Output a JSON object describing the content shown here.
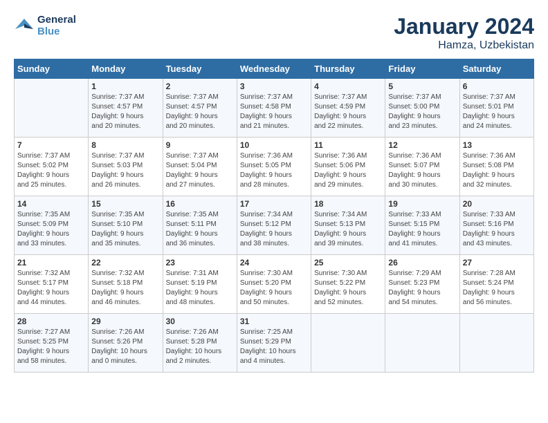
{
  "header": {
    "logo_line1": "General",
    "logo_line2": "Blue",
    "month_year": "January 2024",
    "location": "Hamza, Uzbekistan"
  },
  "days_of_week": [
    "Sunday",
    "Monday",
    "Tuesday",
    "Wednesday",
    "Thursday",
    "Friday",
    "Saturday"
  ],
  "weeks": [
    [
      {
        "day": "",
        "content": ""
      },
      {
        "day": "1",
        "content": "Sunrise: 7:37 AM\nSunset: 4:57 PM\nDaylight: 9 hours\nand 20 minutes."
      },
      {
        "day": "2",
        "content": "Sunrise: 7:37 AM\nSunset: 4:57 PM\nDaylight: 9 hours\nand 20 minutes."
      },
      {
        "day": "3",
        "content": "Sunrise: 7:37 AM\nSunset: 4:58 PM\nDaylight: 9 hours\nand 21 minutes."
      },
      {
        "day": "4",
        "content": "Sunrise: 7:37 AM\nSunset: 4:59 PM\nDaylight: 9 hours\nand 22 minutes."
      },
      {
        "day": "5",
        "content": "Sunrise: 7:37 AM\nSunset: 5:00 PM\nDaylight: 9 hours\nand 23 minutes."
      },
      {
        "day": "6",
        "content": "Sunrise: 7:37 AM\nSunset: 5:01 PM\nDaylight: 9 hours\nand 24 minutes."
      }
    ],
    [
      {
        "day": "7",
        "content": "Sunrise: 7:37 AM\nSunset: 5:02 PM\nDaylight: 9 hours\nand 25 minutes."
      },
      {
        "day": "8",
        "content": "Sunrise: 7:37 AM\nSunset: 5:03 PM\nDaylight: 9 hours\nand 26 minutes."
      },
      {
        "day": "9",
        "content": "Sunrise: 7:37 AM\nSunset: 5:04 PM\nDaylight: 9 hours\nand 27 minutes."
      },
      {
        "day": "10",
        "content": "Sunrise: 7:36 AM\nSunset: 5:05 PM\nDaylight: 9 hours\nand 28 minutes."
      },
      {
        "day": "11",
        "content": "Sunrise: 7:36 AM\nSunset: 5:06 PM\nDaylight: 9 hours\nand 29 minutes."
      },
      {
        "day": "12",
        "content": "Sunrise: 7:36 AM\nSunset: 5:07 PM\nDaylight: 9 hours\nand 30 minutes."
      },
      {
        "day": "13",
        "content": "Sunrise: 7:36 AM\nSunset: 5:08 PM\nDaylight: 9 hours\nand 32 minutes."
      }
    ],
    [
      {
        "day": "14",
        "content": "Sunrise: 7:35 AM\nSunset: 5:09 PM\nDaylight: 9 hours\nand 33 minutes."
      },
      {
        "day": "15",
        "content": "Sunrise: 7:35 AM\nSunset: 5:10 PM\nDaylight: 9 hours\nand 35 minutes."
      },
      {
        "day": "16",
        "content": "Sunrise: 7:35 AM\nSunset: 5:11 PM\nDaylight: 9 hours\nand 36 minutes."
      },
      {
        "day": "17",
        "content": "Sunrise: 7:34 AM\nSunset: 5:12 PM\nDaylight: 9 hours\nand 38 minutes."
      },
      {
        "day": "18",
        "content": "Sunrise: 7:34 AM\nSunset: 5:13 PM\nDaylight: 9 hours\nand 39 minutes."
      },
      {
        "day": "19",
        "content": "Sunrise: 7:33 AM\nSunset: 5:15 PM\nDaylight: 9 hours\nand 41 minutes."
      },
      {
        "day": "20",
        "content": "Sunrise: 7:33 AM\nSunset: 5:16 PM\nDaylight: 9 hours\nand 43 minutes."
      }
    ],
    [
      {
        "day": "21",
        "content": "Sunrise: 7:32 AM\nSunset: 5:17 PM\nDaylight: 9 hours\nand 44 minutes."
      },
      {
        "day": "22",
        "content": "Sunrise: 7:32 AM\nSunset: 5:18 PM\nDaylight: 9 hours\nand 46 minutes."
      },
      {
        "day": "23",
        "content": "Sunrise: 7:31 AM\nSunset: 5:19 PM\nDaylight: 9 hours\nand 48 minutes."
      },
      {
        "day": "24",
        "content": "Sunrise: 7:30 AM\nSunset: 5:20 PM\nDaylight: 9 hours\nand 50 minutes."
      },
      {
        "day": "25",
        "content": "Sunrise: 7:30 AM\nSunset: 5:22 PM\nDaylight: 9 hours\nand 52 minutes."
      },
      {
        "day": "26",
        "content": "Sunrise: 7:29 AM\nSunset: 5:23 PM\nDaylight: 9 hours\nand 54 minutes."
      },
      {
        "day": "27",
        "content": "Sunrise: 7:28 AM\nSunset: 5:24 PM\nDaylight: 9 hours\nand 56 minutes."
      }
    ],
    [
      {
        "day": "28",
        "content": "Sunrise: 7:27 AM\nSunset: 5:25 PM\nDaylight: 9 hours\nand 58 minutes."
      },
      {
        "day": "29",
        "content": "Sunrise: 7:26 AM\nSunset: 5:26 PM\nDaylight: 10 hours\nand 0 minutes."
      },
      {
        "day": "30",
        "content": "Sunrise: 7:26 AM\nSunset: 5:28 PM\nDaylight: 10 hours\nand 2 minutes."
      },
      {
        "day": "31",
        "content": "Sunrise: 7:25 AM\nSunset: 5:29 PM\nDaylight: 10 hours\nand 4 minutes."
      },
      {
        "day": "",
        "content": ""
      },
      {
        "day": "",
        "content": ""
      },
      {
        "day": "",
        "content": ""
      }
    ]
  ]
}
